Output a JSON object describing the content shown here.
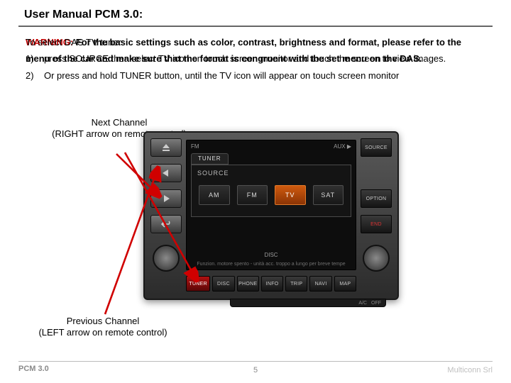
{
  "title": "User Manual PCM 3.0:",
  "textblock": {
    "warn_prefix": "WARNING:",
    "warn_rest_bold": " For the basic settings such as color, contrast, brightness and format, please refer to the menu of the car and make sure that the format is congruent with the set menu on the DAS.",
    "front_line1": "To select DAS TV tuner:",
    "front_step1_num": "1)",
    "front_step1": "press SOURCE then select TV icon on touch screen monitor and touch the screen to view images.",
    "front_step2_num": "2)",
    "front_step2": "Or press and hold TUNER button, until the TV icon will appear on touch screen monitor"
  },
  "callouts": {
    "top_line1": "Next Channel",
    "top_line2": "(RIGHT arrow on remote control)",
    "bottom_line1": "Previous Channel",
    "bottom_line2": "(LEFT arrow on remote control)"
  },
  "device": {
    "bottom_buttons": [
      "TUNER",
      "DISC",
      "PHONE",
      "INFO",
      "TRIP",
      "NAVI",
      "MAP"
    ],
    "side_left_icons": [
      "eject-icon",
      "chevron-left-icon",
      "chevron-right-icon",
      "back-icon"
    ],
    "side_right_btn_top": "SOURCE",
    "side_right_btn_mid": "OPTION",
    "side_right_btn_bot": "END",
    "screen": {
      "top_left": "FM",
      "top_right": "AUX ▶",
      "tab": "TUNER",
      "panel_title": "SOURCE",
      "buttons": [
        "AM",
        "FM",
        "TV",
        "SAT"
      ],
      "active": "TV",
      "footer": "DISC",
      "footer_sub": "Funzion. motore spento - unità acc. troppo a lungo per breve tempe"
    },
    "ac": {
      "off": "A/C",
      "off2": "OFF"
    }
  },
  "footer": {
    "left": "PCM 3.0",
    "center": "5",
    "right": "Multiconn Srl"
  }
}
